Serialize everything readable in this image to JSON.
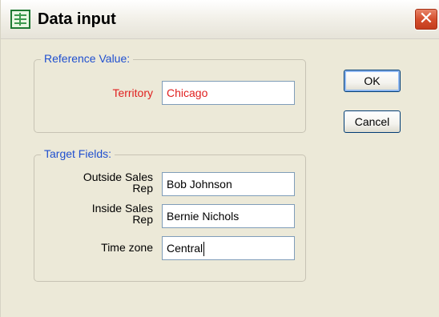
{
  "window": {
    "title": "Data input",
    "app_icon": "spreadsheet-icon",
    "close_glyph": "✕"
  },
  "reference_group": {
    "legend": "Reference Value:",
    "fields": [
      {
        "label": "Territory",
        "value": "Chicago"
      }
    ]
  },
  "target_group": {
    "legend": "Target Fields:",
    "fields": [
      {
        "label_line1": "Outside Sales",
        "label_line2": "Rep",
        "value": "Bob Johnson"
      },
      {
        "label_line1": "Inside Sales",
        "label_line2": "Rep",
        "value": "Bernie Nichols"
      },
      {
        "label": "Time zone",
        "value": "Central"
      }
    ]
  },
  "buttons": {
    "ok": "OK",
    "cancel": "Cancel"
  },
  "colors": {
    "legend_text": "#1f4fcf",
    "reference_text": "#e0201f",
    "window_bg": "#ece9d8",
    "close_button": "#d54f2e"
  }
}
